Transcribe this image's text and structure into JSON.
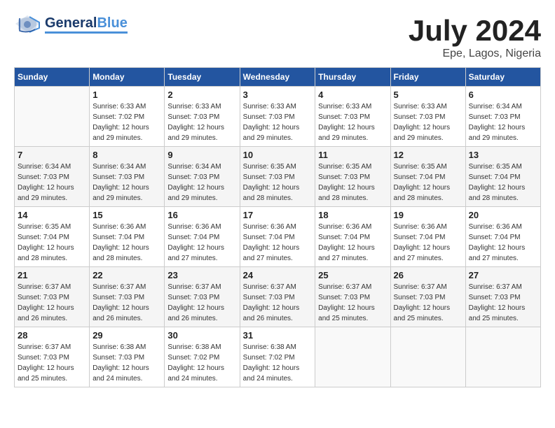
{
  "header": {
    "logo_general": "General",
    "logo_blue": "Blue",
    "title": "July 2024",
    "location": "Epe, Lagos, Nigeria"
  },
  "days_of_week": [
    "Sunday",
    "Monday",
    "Tuesday",
    "Wednesday",
    "Thursday",
    "Friday",
    "Saturday"
  ],
  "weeks": [
    [
      {
        "day": "",
        "info": ""
      },
      {
        "day": "1",
        "info": "Sunrise: 6:33 AM\nSunset: 7:02 PM\nDaylight: 12 hours\nand 29 minutes."
      },
      {
        "day": "2",
        "info": "Sunrise: 6:33 AM\nSunset: 7:03 PM\nDaylight: 12 hours\nand 29 minutes."
      },
      {
        "day": "3",
        "info": "Sunrise: 6:33 AM\nSunset: 7:03 PM\nDaylight: 12 hours\nand 29 minutes."
      },
      {
        "day": "4",
        "info": "Sunrise: 6:33 AM\nSunset: 7:03 PM\nDaylight: 12 hours\nand 29 minutes."
      },
      {
        "day": "5",
        "info": "Sunrise: 6:33 AM\nSunset: 7:03 PM\nDaylight: 12 hours\nand 29 minutes."
      },
      {
        "day": "6",
        "info": "Sunrise: 6:34 AM\nSunset: 7:03 PM\nDaylight: 12 hours\nand 29 minutes."
      }
    ],
    [
      {
        "day": "7",
        "info": "Sunrise: 6:34 AM\nSunset: 7:03 PM\nDaylight: 12 hours\nand 29 minutes."
      },
      {
        "day": "8",
        "info": "Sunrise: 6:34 AM\nSunset: 7:03 PM\nDaylight: 12 hours\nand 29 minutes."
      },
      {
        "day": "9",
        "info": "Sunrise: 6:34 AM\nSunset: 7:03 PM\nDaylight: 12 hours\nand 29 minutes."
      },
      {
        "day": "10",
        "info": "Sunrise: 6:35 AM\nSunset: 7:03 PM\nDaylight: 12 hours\nand 28 minutes."
      },
      {
        "day": "11",
        "info": "Sunrise: 6:35 AM\nSunset: 7:03 PM\nDaylight: 12 hours\nand 28 minutes."
      },
      {
        "day": "12",
        "info": "Sunrise: 6:35 AM\nSunset: 7:04 PM\nDaylight: 12 hours\nand 28 minutes."
      },
      {
        "day": "13",
        "info": "Sunrise: 6:35 AM\nSunset: 7:04 PM\nDaylight: 12 hours\nand 28 minutes."
      }
    ],
    [
      {
        "day": "14",
        "info": "Sunrise: 6:35 AM\nSunset: 7:04 PM\nDaylight: 12 hours\nand 28 minutes."
      },
      {
        "day": "15",
        "info": "Sunrise: 6:36 AM\nSunset: 7:04 PM\nDaylight: 12 hours\nand 28 minutes."
      },
      {
        "day": "16",
        "info": "Sunrise: 6:36 AM\nSunset: 7:04 PM\nDaylight: 12 hours\nand 27 minutes."
      },
      {
        "day": "17",
        "info": "Sunrise: 6:36 AM\nSunset: 7:04 PM\nDaylight: 12 hours\nand 27 minutes."
      },
      {
        "day": "18",
        "info": "Sunrise: 6:36 AM\nSunset: 7:04 PM\nDaylight: 12 hours\nand 27 minutes."
      },
      {
        "day": "19",
        "info": "Sunrise: 6:36 AM\nSunset: 7:04 PM\nDaylight: 12 hours\nand 27 minutes."
      },
      {
        "day": "20",
        "info": "Sunrise: 6:36 AM\nSunset: 7:04 PM\nDaylight: 12 hours\nand 27 minutes."
      }
    ],
    [
      {
        "day": "21",
        "info": "Sunrise: 6:37 AM\nSunset: 7:03 PM\nDaylight: 12 hours\nand 26 minutes."
      },
      {
        "day": "22",
        "info": "Sunrise: 6:37 AM\nSunset: 7:03 PM\nDaylight: 12 hours\nand 26 minutes."
      },
      {
        "day": "23",
        "info": "Sunrise: 6:37 AM\nSunset: 7:03 PM\nDaylight: 12 hours\nand 26 minutes."
      },
      {
        "day": "24",
        "info": "Sunrise: 6:37 AM\nSunset: 7:03 PM\nDaylight: 12 hours\nand 26 minutes."
      },
      {
        "day": "25",
        "info": "Sunrise: 6:37 AM\nSunset: 7:03 PM\nDaylight: 12 hours\nand 25 minutes."
      },
      {
        "day": "26",
        "info": "Sunrise: 6:37 AM\nSunset: 7:03 PM\nDaylight: 12 hours\nand 25 minutes."
      },
      {
        "day": "27",
        "info": "Sunrise: 6:37 AM\nSunset: 7:03 PM\nDaylight: 12 hours\nand 25 minutes."
      }
    ],
    [
      {
        "day": "28",
        "info": "Sunrise: 6:37 AM\nSunset: 7:03 PM\nDaylight: 12 hours\nand 25 minutes."
      },
      {
        "day": "29",
        "info": "Sunrise: 6:38 AM\nSunset: 7:03 PM\nDaylight: 12 hours\nand 24 minutes."
      },
      {
        "day": "30",
        "info": "Sunrise: 6:38 AM\nSunset: 7:02 PM\nDaylight: 12 hours\nand 24 minutes."
      },
      {
        "day": "31",
        "info": "Sunrise: 6:38 AM\nSunset: 7:02 PM\nDaylight: 12 hours\nand 24 minutes."
      },
      {
        "day": "",
        "info": ""
      },
      {
        "day": "",
        "info": ""
      },
      {
        "day": "",
        "info": ""
      }
    ]
  ]
}
